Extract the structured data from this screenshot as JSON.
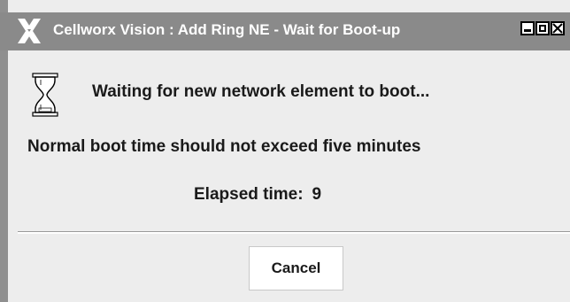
{
  "window": {
    "title": "Cellworx Vision : Add Ring NE - Wait for Boot-up",
    "app_icon": "x-logo-icon",
    "controls": [
      "minimize-icon",
      "maximize-icon",
      "close-icon"
    ]
  },
  "content": {
    "status_icon": "hourglass-icon",
    "waiting_message": "Waiting for new network element to boot...",
    "info_message": "Normal boot time should not exceed five minutes",
    "elapsed_label": "Elapsed time:",
    "elapsed_value": "9"
  },
  "buttons": {
    "cancel_label": "Cancel"
  },
  "colors": {
    "titlebar": "#8a8a8a",
    "dialog_background": "#ededed",
    "text": "#1a1a1a"
  }
}
